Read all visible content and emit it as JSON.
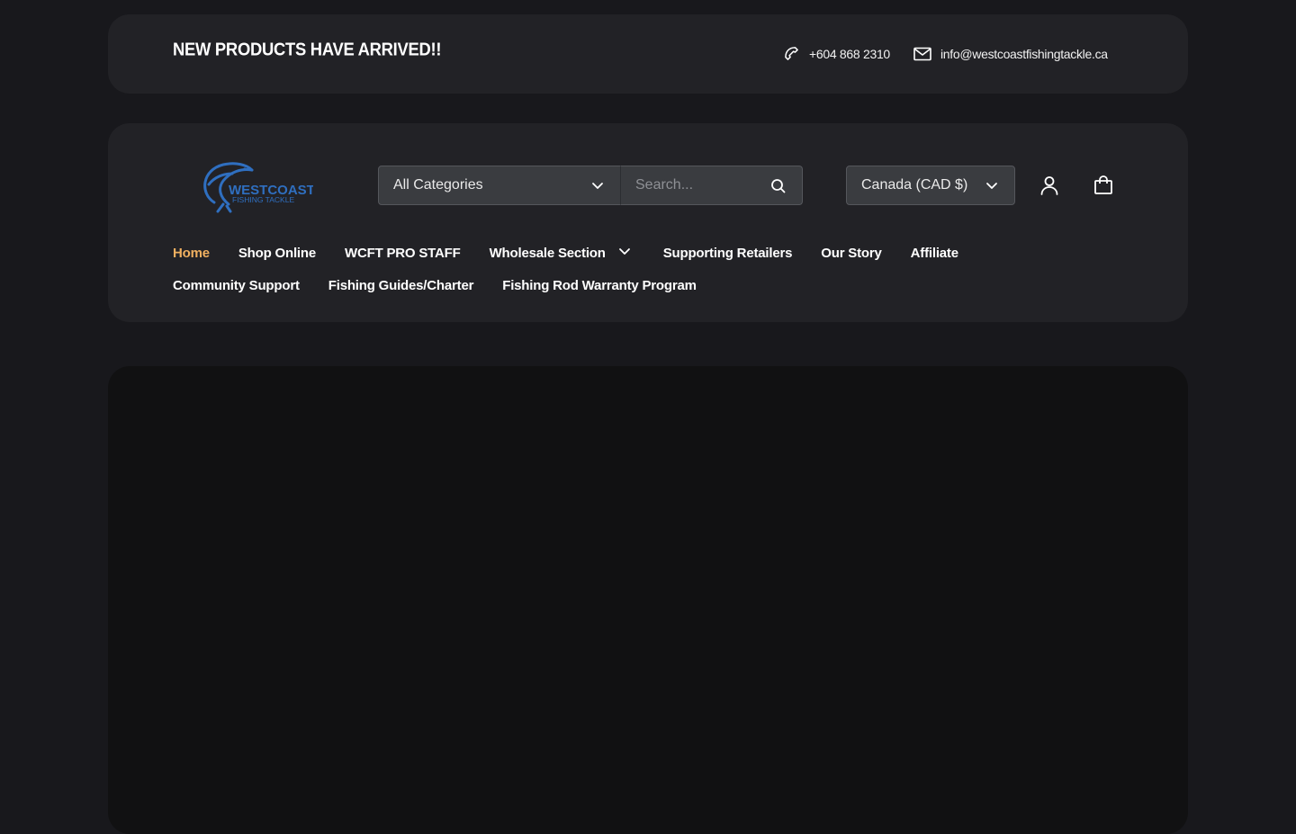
{
  "announcement": {
    "title": "NEW PRODUCTS HAVE ARRIVED!!",
    "phone": "+604 868 2310",
    "email": "info@westcoastfishingtackle.ca"
  },
  "header": {
    "logo": {
      "line1": "WESTCOAST",
      "line2": "FISHING TACKLE"
    },
    "category_select": "All Categories",
    "search_placeholder": "Search...",
    "currency": "Canada (CAD $)"
  },
  "nav": {
    "row1": [
      {
        "label": "Home",
        "active": true
      },
      {
        "label": "Shop Online"
      },
      {
        "label": "WCFT PRO STAFF"
      },
      {
        "label": "Wholesale Section",
        "dropdown": true
      },
      {
        "label": "Supporting Retailers"
      },
      {
        "label": "Our Story"
      },
      {
        "label": "Affiliate"
      }
    ],
    "row2": [
      {
        "label": "Community Support"
      },
      {
        "label": "Fishing Guides/Charter"
      },
      {
        "label": "Fishing Rod Warranty Program"
      }
    ]
  },
  "colors": {
    "page_bg": "#18181c",
    "panel_bg": "#222226",
    "active_nav": "#f0b060",
    "hero_bg": "#111112",
    "logo_blue": "#2f6fc0"
  }
}
